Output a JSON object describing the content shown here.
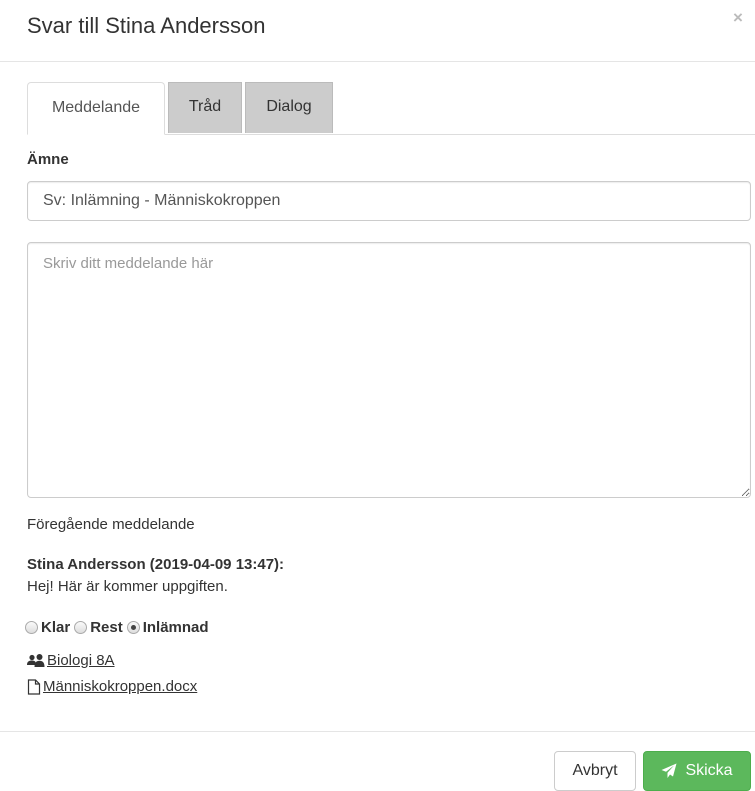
{
  "dialog": {
    "title": "Svar till Stina Andersson",
    "close": "×"
  },
  "tabs": [
    {
      "label": "Meddelande",
      "active": true
    },
    {
      "label": "Tråd",
      "active": false
    },
    {
      "label": "Dialog",
      "active": false
    }
  ],
  "subject": {
    "label": "Ämne",
    "value": "Sv: Inlämning - Människokroppen"
  },
  "message": {
    "placeholder": "Skriv ditt meddelande här",
    "value": ""
  },
  "previous": {
    "label": "Föregående meddelande",
    "author": "Stina Andersson (2019-04-09 13:47):",
    "body": "Hej! Här är kommer uppgiften."
  },
  "status": {
    "options": [
      {
        "label": "Klar",
        "checked": false
      },
      {
        "label": "Rest",
        "checked": false
      },
      {
        "label": "Inlämnad",
        "checked": true
      }
    ]
  },
  "links": {
    "group": "Biologi 8A",
    "file": "Människokroppen.docx"
  },
  "footer": {
    "cancel_label": "Avbryt",
    "send_label": "Skicka"
  },
  "colors": {
    "send": "#5cb85c",
    "tab_inactive": "#cccccc"
  },
  "icons": {
    "group": "users-icon",
    "file": "file-icon",
    "send": "paper-plane-icon"
  }
}
